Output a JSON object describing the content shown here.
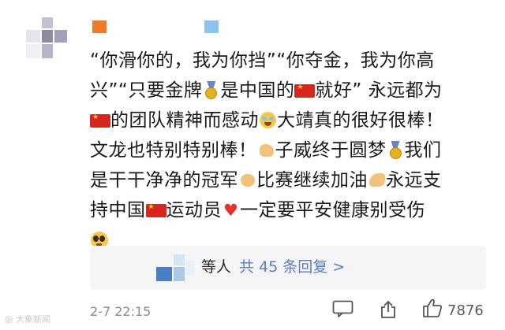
{
  "comment": {
    "line1": "“你滑你的，我为你挡”“你夺金，我为你高",
    "line2a": "兴”“只要金牌",
    "line2b": "是中国的",
    "line2c": "就好” 永远都为",
    "line3a": "的团队精神而感动",
    "line3b": "大靖真的很好很棒！",
    "line4a": "文龙也特别特别棒！",
    "line4b": "子威终于圆梦",
    "line4c": "我们",
    "line5a": "是干干净净的冠军",
    "line5b": "比赛继续加油",
    "line5c": "永远支",
    "line6a": "持中国",
    "line6b": "运动员",
    "line6c": "一定要平安健康别受伤"
  },
  "emojis": {
    "medal": "medal-icon",
    "flag": "china-flag-icon",
    "crying": "crying-face-icon",
    "ok_hand": "ok-hand-icon",
    "fist": "fist-icon",
    "flexed": "flexed-biceps-icon",
    "heart": "red-heart-icon",
    "pleading": "pleading-face-icon"
  },
  "replies": {
    "who": "等人",
    "link": "共 45 条回复 >"
  },
  "footer": {
    "time": "2-7 22:15",
    "like_count": "7876"
  },
  "watermark": "大象新闻",
  "colors": {
    "link": "#5b7fb8",
    "text": "#1a1a1a",
    "meta": "#8a8a8a",
    "reply_bg": "#f5f5f7"
  }
}
